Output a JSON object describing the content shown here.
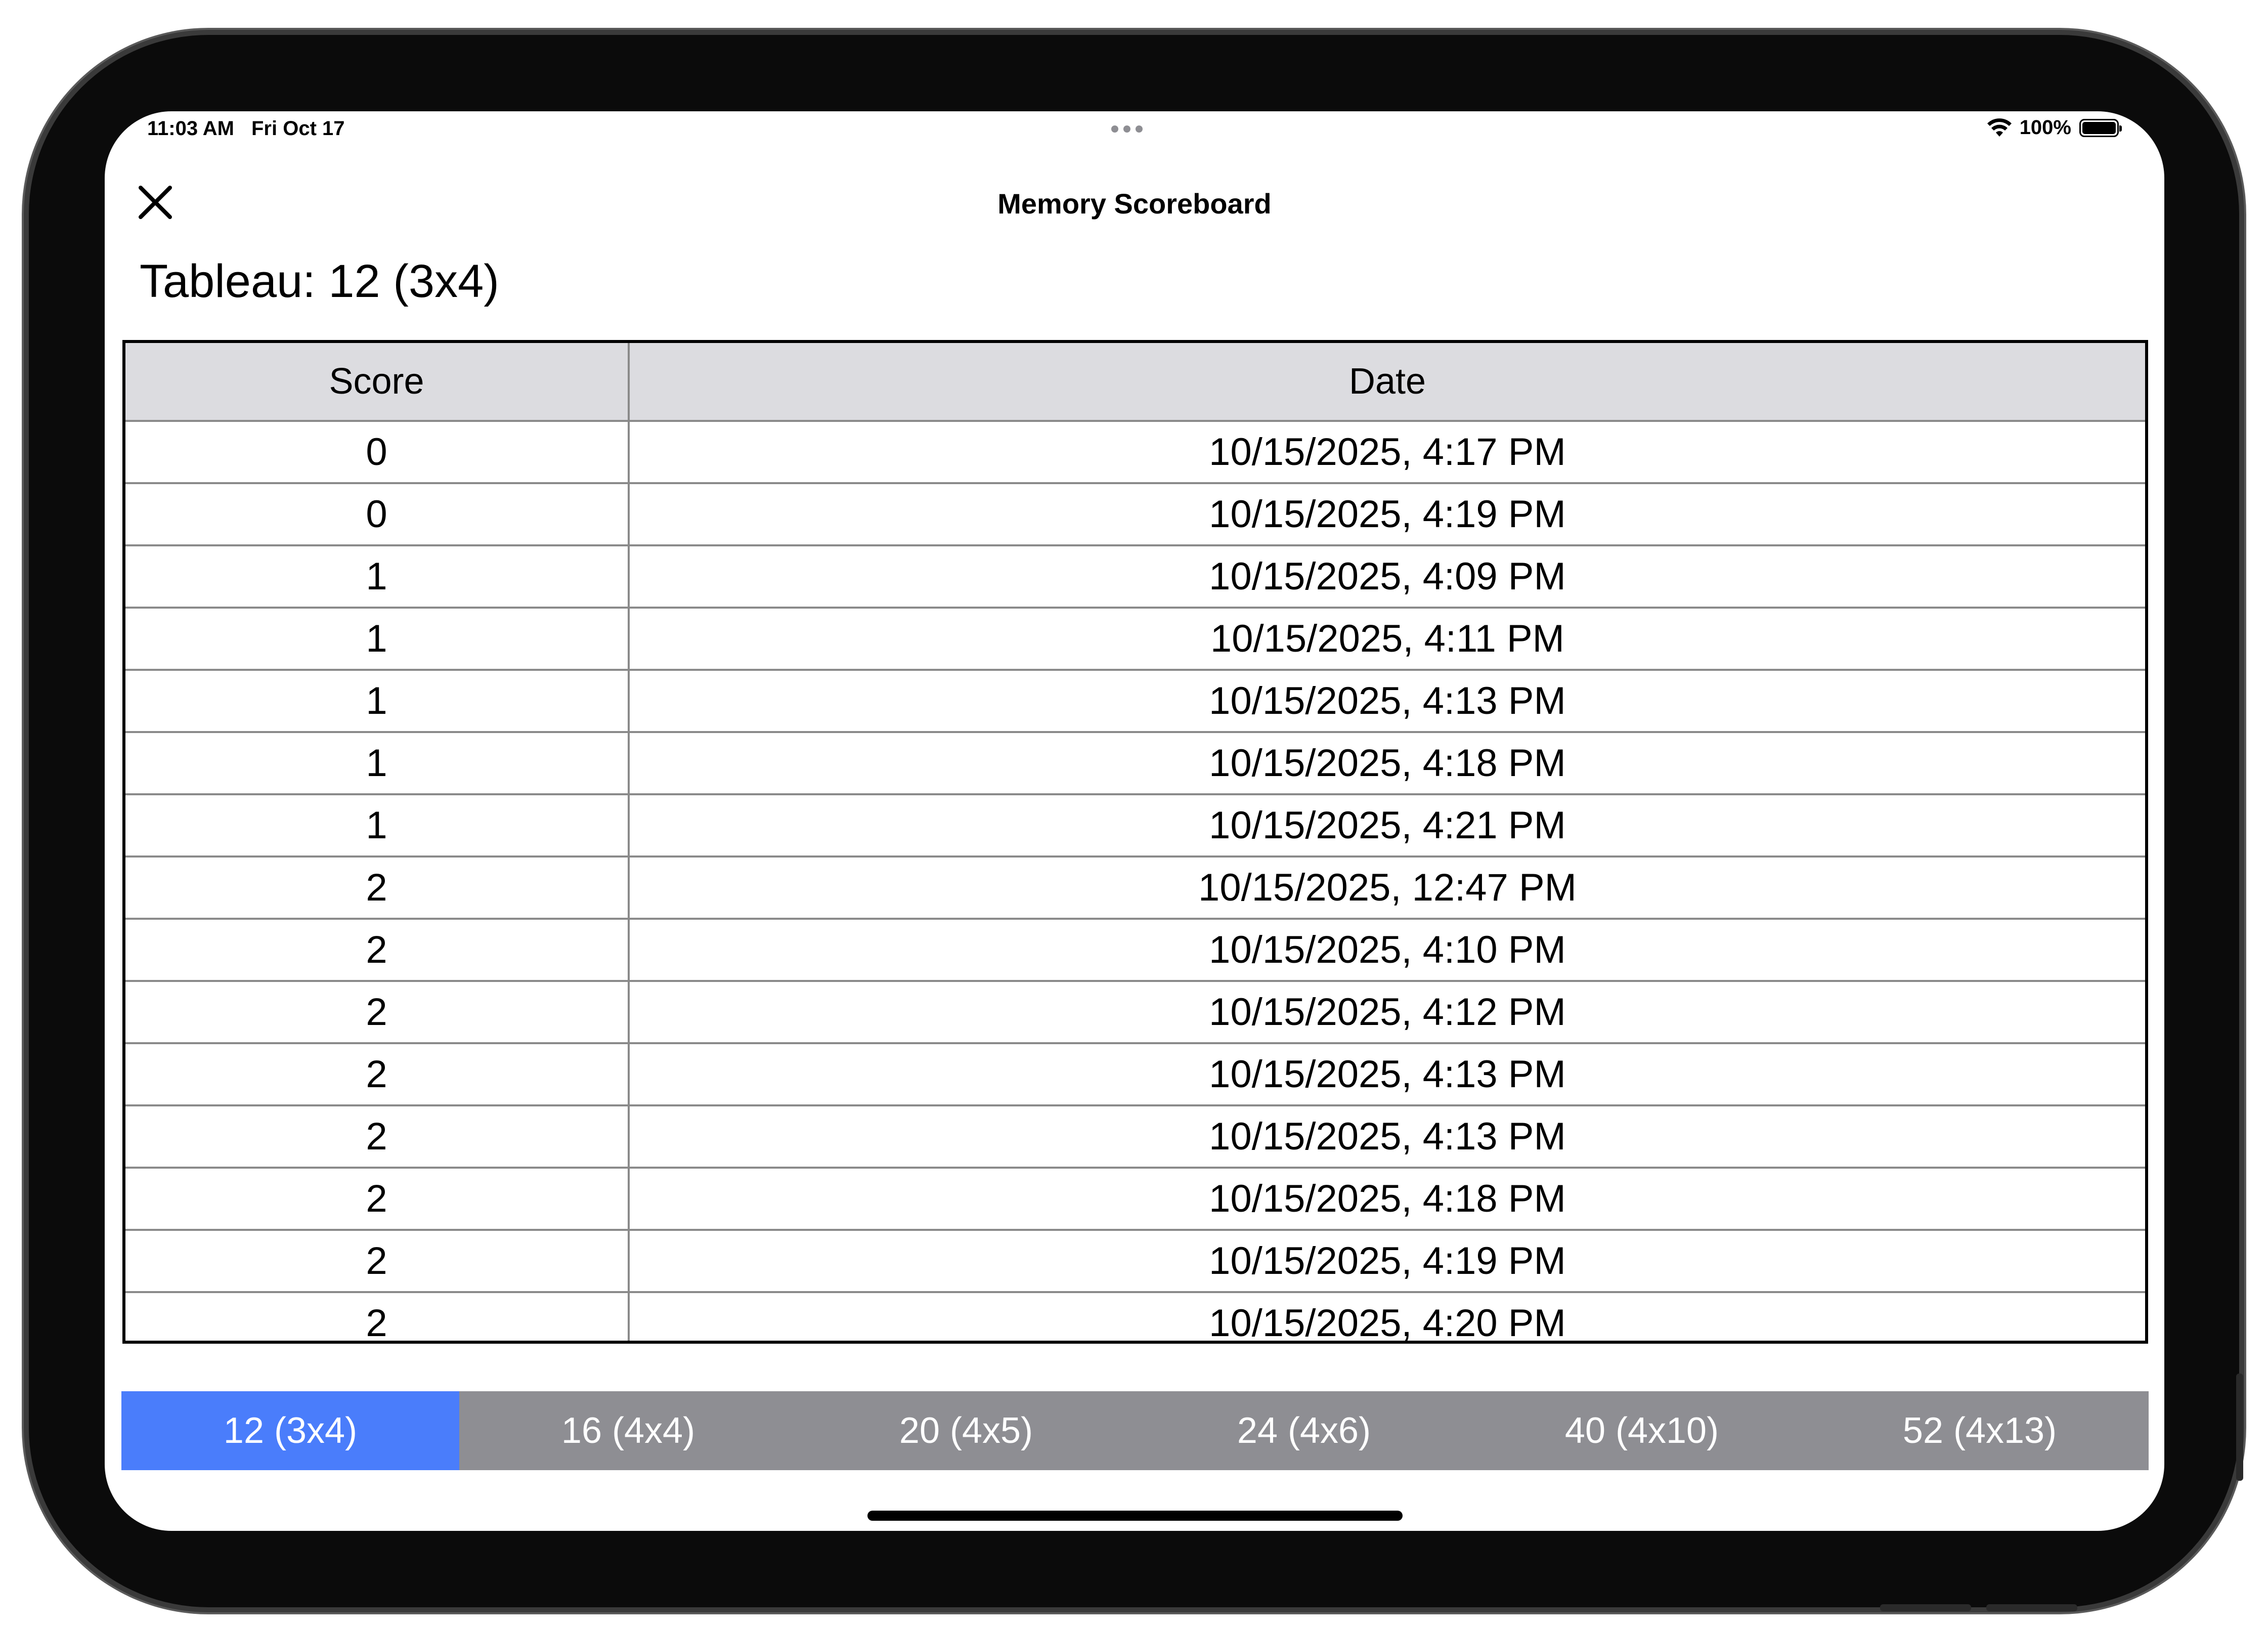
{
  "status_bar": {
    "time": "11:03 AM",
    "date": "Fri Oct 17",
    "battery": "100%"
  },
  "nav": {
    "title": "Memory Scoreboard"
  },
  "tableau_title": "Tableau: 12 (3x4)",
  "table": {
    "headers": [
      "Score",
      "Date"
    ],
    "rows": [
      {
        "score": "0",
        "date": "10/15/2025, 4:17 PM"
      },
      {
        "score": "0",
        "date": "10/15/2025, 4:19 PM"
      },
      {
        "score": "1",
        "date": "10/15/2025, 4:09 PM"
      },
      {
        "score": "1",
        "date": "10/15/2025, 4:11 PM"
      },
      {
        "score": "1",
        "date": "10/15/2025, 4:13 PM"
      },
      {
        "score": "1",
        "date": "10/15/2025, 4:18 PM"
      },
      {
        "score": "1",
        "date": "10/15/2025, 4:21 PM"
      },
      {
        "score": "2",
        "date": "10/15/2025, 12:47 PM"
      },
      {
        "score": "2",
        "date": "10/15/2025, 4:10 PM"
      },
      {
        "score": "2",
        "date": "10/15/2025, 4:12 PM"
      },
      {
        "score": "2",
        "date": "10/15/2025, 4:13 PM"
      },
      {
        "score": "2",
        "date": "10/15/2025, 4:13 PM"
      },
      {
        "score": "2",
        "date": "10/15/2025, 4:18 PM"
      },
      {
        "score": "2",
        "date": "10/15/2025, 4:19 PM"
      },
      {
        "score": "2",
        "date": "10/15/2025, 4:20 PM"
      }
    ]
  },
  "segments": {
    "selected": "12 (3x4)",
    "items": [
      "12 (3x4)",
      "16 (4x4)",
      "20 (4x5)",
      "24 (4x6)",
      "40 (4x10)",
      "52 (4x13)"
    ]
  },
  "colors": {
    "accent": "#4a7dfb",
    "segment_bg": "#8e8e93",
    "header_bg": "#dcdce0"
  }
}
